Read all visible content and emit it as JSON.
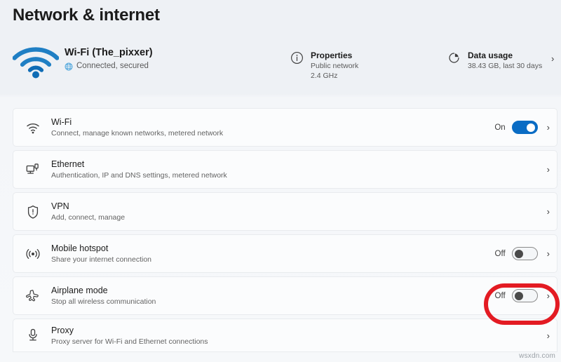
{
  "page": {
    "title": "Network & internet"
  },
  "status": {
    "icon": "wifi-signal-icon",
    "name": "Wi-Fi (The_pixxer)",
    "connection_icon": "globe-icon",
    "connection_text": "Connected, secured",
    "accent_color": "#0f75bc"
  },
  "summary": [
    {
      "name": "properties",
      "icon": "info-circle-icon",
      "title": "Properties",
      "lines": [
        "Public network",
        "2.4 GHz"
      ]
    },
    {
      "name": "data-usage",
      "icon": "pie-chart-icon",
      "title": "Data usage",
      "lines": [
        "38.43 GB, last 30 days"
      ],
      "chevron": "›"
    }
  ],
  "settings": [
    {
      "name": "wi-fi",
      "icon": "wifi-icon",
      "title": "Wi-Fi",
      "description": "Connect, manage known networks, metered network",
      "toggle_label": "On",
      "toggle_state": "on",
      "chevron": "›"
    },
    {
      "name": "ethernet",
      "icon": "ethernet-icon",
      "title": "Ethernet",
      "description": "Authentication, IP and DNS settings, metered network",
      "toggle_label": null,
      "toggle_state": null,
      "chevron": "›"
    },
    {
      "name": "vpn",
      "icon": "shield-icon",
      "title": "VPN",
      "description": "Add, connect, manage",
      "toggle_label": null,
      "toggle_state": null,
      "chevron": "›"
    },
    {
      "name": "mobile-hotspot",
      "icon": "hotspot-icon",
      "title": "Mobile hotspot",
      "description": "Share your internet connection",
      "toggle_label": "Off",
      "toggle_state": "off",
      "chevron": "›"
    },
    {
      "name": "airplane-mode",
      "icon": "airplane-icon",
      "title": "Airplane mode",
      "description": "Stop all wireless communication",
      "toggle_label": "Off",
      "toggle_state": "off",
      "chevron": "›",
      "highlighted": true
    },
    {
      "name": "proxy",
      "icon": "proxy-icon",
      "title": "Proxy",
      "description": "Proxy server for Wi-Fi and Ethernet connections",
      "toggle_label": null,
      "toggle_state": null,
      "chevron": "›"
    }
  ],
  "annotation": {
    "name": "airplane-toggle-highlight",
    "color": "#e31b23"
  },
  "watermark": {
    "text": "wsxdn.com"
  }
}
